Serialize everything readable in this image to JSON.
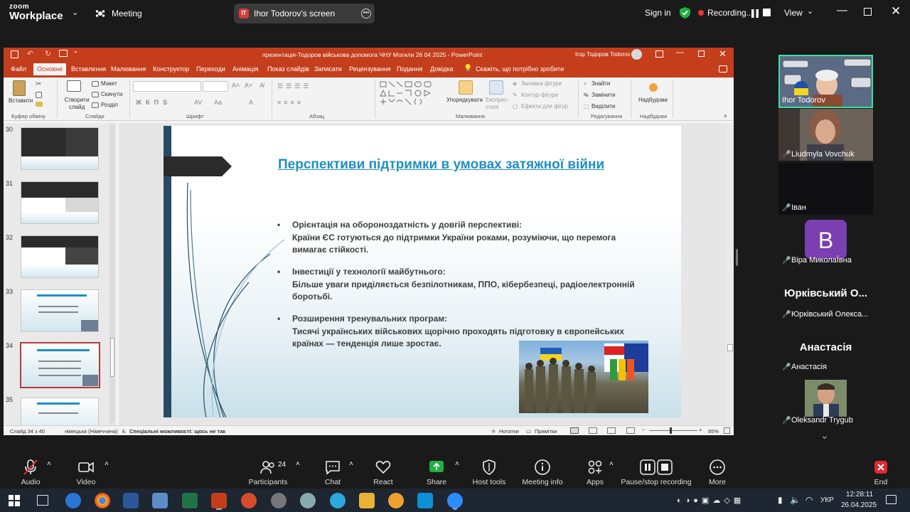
{
  "zoom": {
    "brand_top": "zoom",
    "brand_bottom": "Workplace",
    "meeting_label": "Meeting",
    "share_initials": "IT",
    "share_label": "Ihor Todorov's screen",
    "sign_in": "Sign in",
    "recording": "Recording...",
    "view": "View"
  },
  "ppt": {
    "title": "презентація-Тодоров військова допомога ЧНУ Могили 26 04 2025  -  PowerPoint",
    "user": "Ігор Тодоров Todorov",
    "tabs": [
      "Файл",
      "Основне",
      "Вставлення",
      "Малювання",
      "Конструктор",
      "Переходи",
      "Анімація",
      "Показ слайдів",
      "Записати",
      "Рецензування",
      "Подання",
      "Довідка"
    ],
    "active_tab": "Основне",
    "tell_me": "Скажіть, що потрібно зробити",
    "ribbon": {
      "paste": "Вставити",
      "clipboard": "Буфер обміну",
      "new_slide": "Створити слайд",
      "layout": "Макет",
      "reset": "Скинути",
      "section": "Розділ",
      "slides": "Слайди",
      "font": "Шрифт",
      "paragraph": "Абзац",
      "arrange": "Упорядкувати",
      "quick_styles": "Експрес-стилі",
      "fill": "Заливка фігури",
      "outline": "Контур фігури",
      "effects": "Ефекти для фігур",
      "drawing": "Малювання",
      "find": "Знайти",
      "replace": "Замінити",
      "select": "Виділити",
      "editing": "Редагування",
      "addins": "Надбудови",
      "addins_group": "Надбудови"
    },
    "thumbnails": [
      {
        "num": "30"
      },
      {
        "num": "31"
      },
      {
        "num": "32"
      },
      {
        "num": "33"
      },
      {
        "num": "34"
      },
      {
        "num": "35"
      }
    ],
    "slide": {
      "title": "Перспективи підтримки в умовах затяжної війни",
      "bullets": [
        {
          "head": "Орієнтація на обороноздатність у довгій перспективі:",
          "body": "Країни ЄС готуються до підтримки України роками, розуміючи, що перемога вимагає стійкості."
        },
        {
          "head": "Інвестиції у технології майбутнього:",
          "body": "Більше уваги приділяється безпілотникам, ППО, кібербезпеці, радіоелектронній боротьбі."
        },
        {
          "head": "Розширення тренувальних програм:",
          "body": "Тисячі українських військових щорічно проходять підготовку в європейських країнах — тенденція лише зростає."
        }
      ]
    },
    "status": {
      "slide_of": "Слайд 34 з 40",
      "language": "німецька (Німеччина)",
      "accessibility": "Спеціальні можливості: щось не так",
      "notes": "Нотатки",
      "comments": "Примітки",
      "zoom": "85%"
    }
  },
  "participants": [
    {
      "name": "Ihor Todorov"
    },
    {
      "name": "Liudmyla Vovchuk"
    },
    {
      "name": "Іван"
    },
    {
      "name": "Віра МиколаЇвна",
      "avatar_letter": "B"
    },
    {
      "name": "Юрківський Олекса...",
      "display": "Юрківський О..."
    },
    {
      "name": "Анастасія",
      "display": "Анастасія"
    },
    {
      "name": "Oleksandr Trygub"
    }
  ],
  "toolbar": {
    "audio": "Audio",
    "video": "Video",
    "participants": "Participants",
    "participants_count": "24",
    "chat": "Chat",
    "react": "React",
    "share": "Share",
    "host_tools": "Host tools",
    "meeting_info": "Meeting info",
    "apps": "Apps",
    "pause_stop": "Pause/stop recording",
    "more": "More",
    "end": "End"
  },
  "taskbar": {
    "lang": "УКР",
    "time": "12:28:11",
    "date": "26.04.2025"
  },
  "colors": {
    "ppt_red": "#c43e1c",
    "title_blue": "#1f8fc4",
    "zoom_green": "#1fb141",
    "active_speaker": "#3ce1a0"
  }
}
